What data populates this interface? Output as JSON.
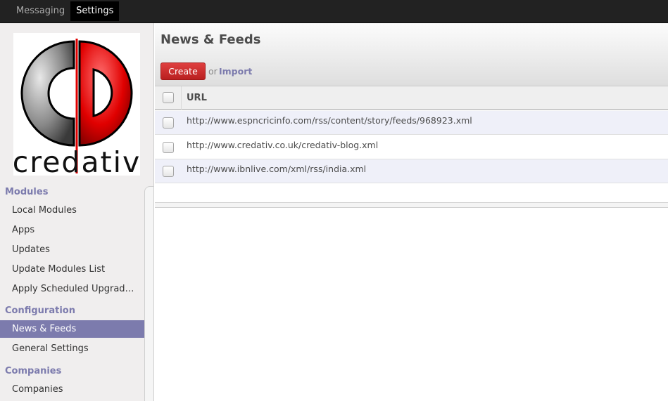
{
  "topbar": {
    "menu": [
      {
        "label": "Messaging",
        "active": false
      },
      {
        "label": "Settings",
        "active": true
      }
    ]
  },
  "sidebar": {
    "logo_text": "credativ",
    "sections": [
      {
        "title": "Modules",
        "items": [
          "Local Modules",
          "Apps",
          "Updates",
          "Update Modules List",
          "Apply Scheduled Upgrad…"
        ]
      },
      {
        "title": "Configuration",
        "items": [
          "News & Feeds",
          "General Settings"
        ]
      },
      {
        "title": "Companies",
        "items": [
          "Companies"
        ]
      }
    ],
    "active_item": "News & Feeds"
  },
  "main": {
    "title": "News & Feeds",
    "create_label": "Create",
    "or_text": "or",
    "import_label": "Import",
    "table": {
      "columns": [
        "URL"
      ],
      "rows": [
        "http://www.espncricinfo.com/rss/content/story/feeds/968923.xml",
        "http://www.credativ.co.uk/credativ-blog.xml",
        "http://www.ibnlive.com/xml/rss/india.xml"
      ]
    }
  },
  "colors": {
    "accent": "#7c7bad",
    "create_button": "#c92a2a",
    "topbar": "#222222",
    "row_alt": "#eff0f9"
  }
}
